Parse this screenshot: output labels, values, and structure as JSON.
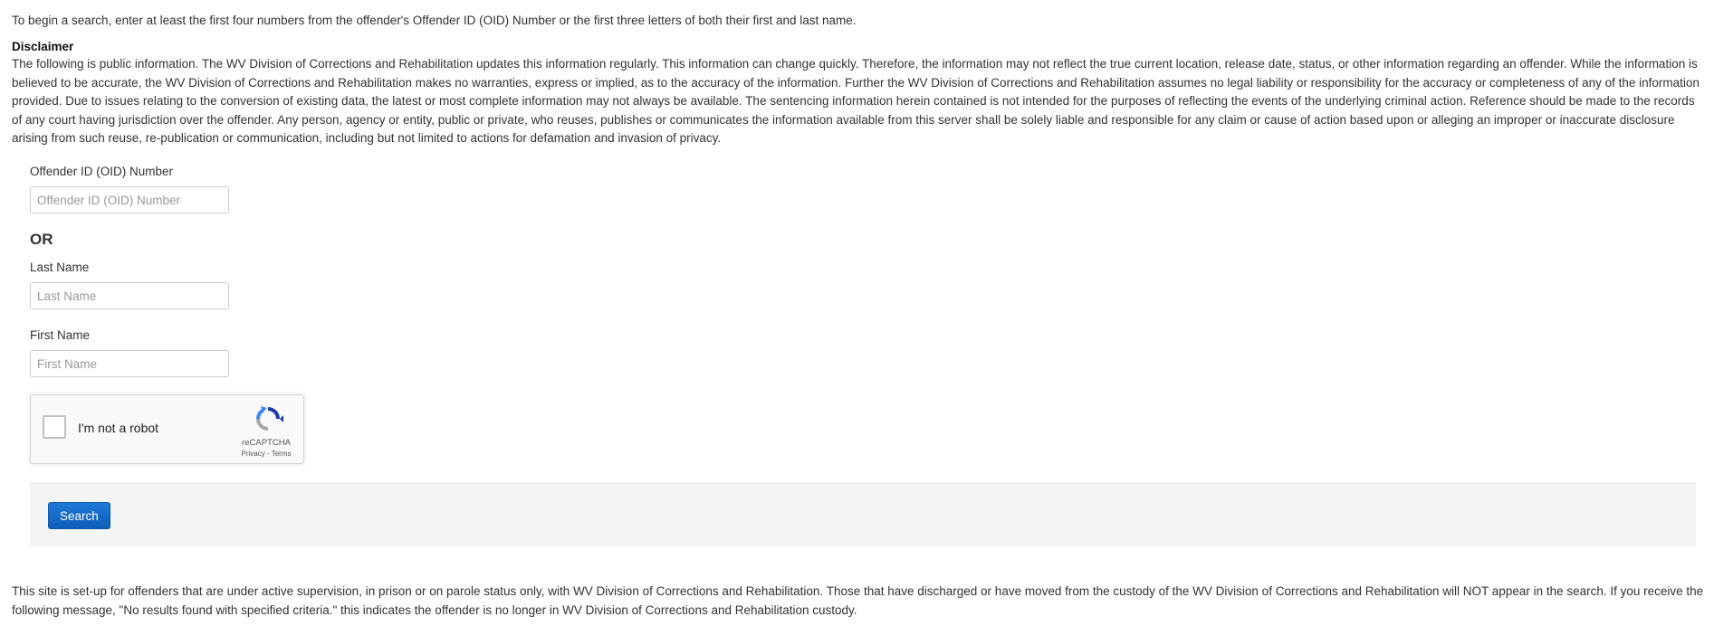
{
  "intro": {
    "text": "To begin a search, enter at least the first four numbers from the offender's Offender ID (OID) Number or the first three letters of both their first and last name."
  },
  "disclaimer": {
    "title": "Disclaimer",
    "body": "The following is public information. The WV Division of Corrections and Rehabilitation updates this information regularly. This information can change quickly. Therefore, the information may not reflect the true current location, release date, status, or other information regarding an offender. While the information is believed to be accurate, the WV Division of Corrections and Rehabilitation makes no warranties, express or implied, as to the accuracy of the information. Further the WV Division of Corrections and Rehabilitation assumes no legal liability or responsibility for the accuracy or completeness of any of the information provided. Due to issues relating to the conversion of existing data, the latest or most complete information may not always be available. The sentencing information herein contained is not intended for the purposes of reflecting the events of the underlying criminal action. Reference should be made to the records of any court having jurisdiction over the offender. Any person, agency or entity, public or private, who reuses, publishes or communicates the information available from this server shall be solely liable and responsible for any claim or cause of action based upon or alleging an improper or inaccurate disclosure arising from such reuse, re-publication or communication, including but not limited to actions for defamation and invasion of privacy."
  },
  "form": {
    "oid": {
      "label": "Offender ID (OID) Number",
      "value": "",
      "placeholder": "Offender ID (OID) Number"
    },
    "or_text": "OR",
    "last_name": {
      "label": "Last Name",
      "value": "",
      "placeholder": "Last Name"
    },
    "first_name": {
      "label": "First Name",
      "value": "",
      "placeholder": "First Name"
    },
    "captcha": {
      "label": "I'm not a robot",
      "brand": "reCAPTCHA",
      "privacy": "Privacy",
      "separator": " - ",
      "terms": "Terms",
      "icon": "recaptcha-logo"
    },
    "search_label": "Search"
  },
  "footer": {
    "text": "This site is set-up for offenders that are under active supervision, in prison or on parole status only, with WV Division of Corrections and Rehabilitation. Those that have discharged or have moved from the custody of the WV Division of Corrections and Rehabilitation will NOT appear in the search. If you receive the following message, \"No results found with specified criteria.\" this indicates the offender is no longer in WV Division of Corrections and Rehabilitation custody."
  },
  "colors": {
    "button": "#1467c8",
    "panel": "#f5f5f5",
    "text": "#333333"
  }
}
